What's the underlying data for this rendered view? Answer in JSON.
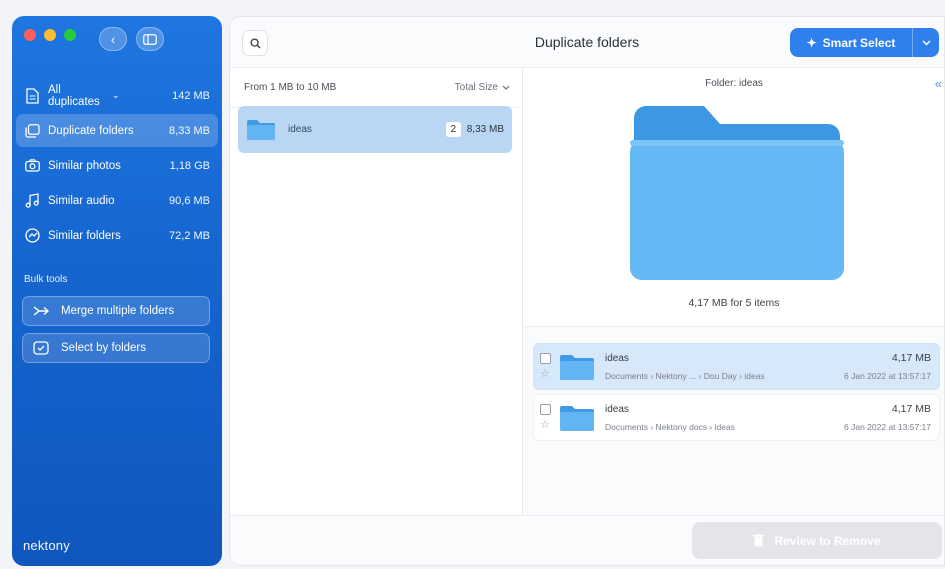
{
  "sidebar": {
    "items": [
      {
        "label": "All duplicates",
        "size": "142 MB",
        "icon": "document-icon"
      },
      {
        "label": "Duplicate folders",
        "size": "8,33 MB",
        "icon": "folders-icon"
      },
      {
        "label": "Similar photos",
        "size": "1,18 GB",
        "icon": "camera-icon"
      },
      {
        "label": "Similar audio",
        "size": "90,6 MB",
        "icon": "music-note-icon"
      },
      {
        "label": "Similar folders",
        "size": "72,2 MB",
        "icon": "similar-icon"
      }
    ],
    "bulk_title": "Bulk tools",
    "merge_label": "Merge multiple folders",
    "select_label": "Select by folders",
    "brand": "nektony"
  },
  "header": {
    "title": "Duplicate folders",
    "smart_select": "Smart Select"
  },
  "list": {
    "filter": "From 1 MB to 10 MB",
    "sort": "Total Size",
    "groups": [
      {
        "name": "ideas",
        "count": "2",
        "size": "8,33 MB"
      }
    ]
  },
  "detail": {
    "folder_label": "Folder: ideas",
    "summary": "4,17 MB for 5 items",
    "files": [
      {
        "name": "ideas",
        "path": "Documents › Nektony ... › Dou Day › ideas",
        "size": "4,17 MB",
        "date": "6 Jan 2022 at 13:57:17"
      },
      {
        "name": "ideas",
        "path": "Documents › Nektony docs › ideas",
        "size": "4,17 MB",
        "date": "6 Jan 2022 at 13:57:17"
      }
    ]
  },
  "footer": {
    "review_label": "Review to Remove"
  },
  "colors": {
    "sidebar": "#1665cf",
    "accent": "#2f80ed",
    "selection": "#b9d7f5",
    "folder": "#5aaef0"
  }
}
